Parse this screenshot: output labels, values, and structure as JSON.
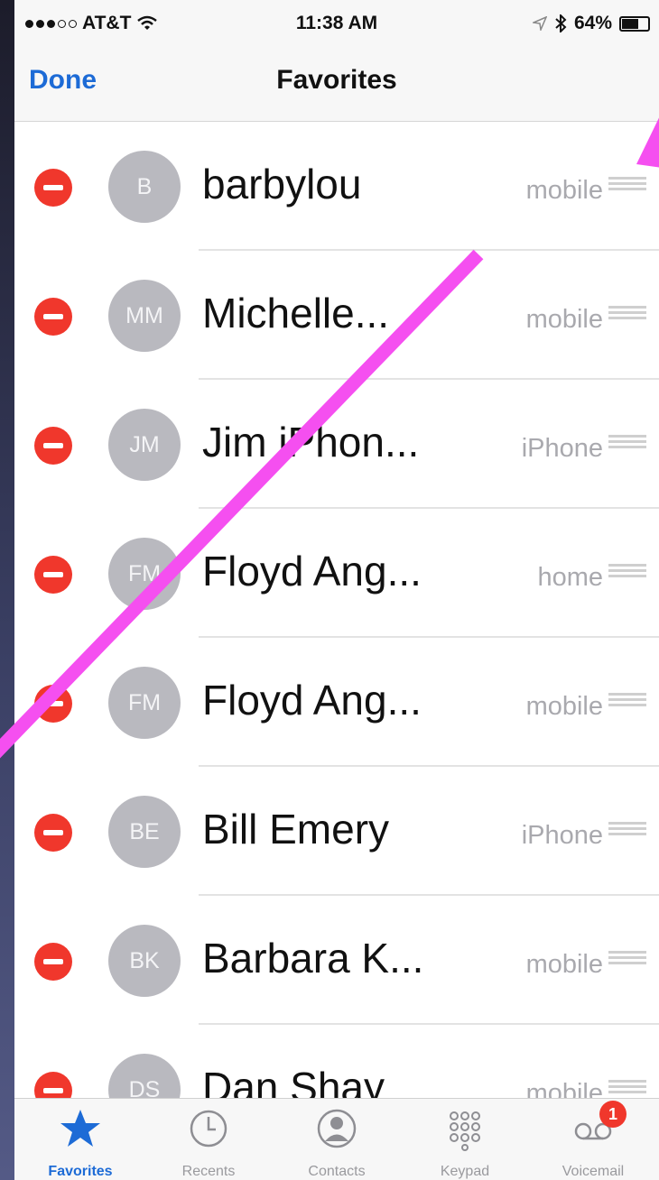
{
  "status_bar": {
    "carrier": "AT&T",
    "time": "11:38 AM",
    "battery": "64%",
    "battery_level": 0.64,
    "signal_bars_filled": 3,
    "signal_bars_total": 5
  },
  "nav": {
    "done_label": "Done",
    "title": "Favorites"
  },
  "favorites": [
    {
      "initials": "B",
      "name": "barbylou",
      "type": "mobile"
    },
    {
      "initials": "MM",
      "name": "Michelle...",
      "type": "mobile"
    },
    {
      "initials": "JM",
      "name": "Jim iPhon...",
      "type": "iPhone"
    },
    {
      "initials": "FM",
      "name": "Floyd Ang...",
      "type": "home"
    },
    {
      "initials": "FM",
      "name": "Floyd Ang...",
      "type": "mobile"
    },
    {
      "initials": "BE",
      "name": "Bill Emery",
      "type": "iPhone"
    },
    {
      "initials": "BK",
      "name": "Barbara K...",
      "type": "mobile"
    },
    {
      "initials": "DS",
      "name": "Dan Shay",
      "type": "mobile"
    }
  ],
  "tab_bar": {
    "favorites_label": "Favorites",
    "recents_label": "Recents",
    "contacts_label": "Contacts",
    "keypad_label": "Keypad",
    "voicemail_label": "Voicemail",
    "voicemail_badge": "1",
    "active": "Favorites"
  },
  "colors": {
    "accent": "#1d6bd6",
    "delete": "#f0372c",
    "annotation_arrow": "#f54ff0"
  },
  "icons": {
    "delete": "minus-circle-icon",
    "reorder": "reorder-handle-icon",
    "favorites": "star-icon",
    "recents": "clock-icon",
    "contacts": "person-icon",
    "keypad": "keypad-icon",
    "voicemail": "voicemail-icon",
    "wifi": "wifi-icon",
    "location": "location-arrow-icon",
    "bluetooth": "bluetooth-icon",
    "battery": "battery-icon"
  }
}
